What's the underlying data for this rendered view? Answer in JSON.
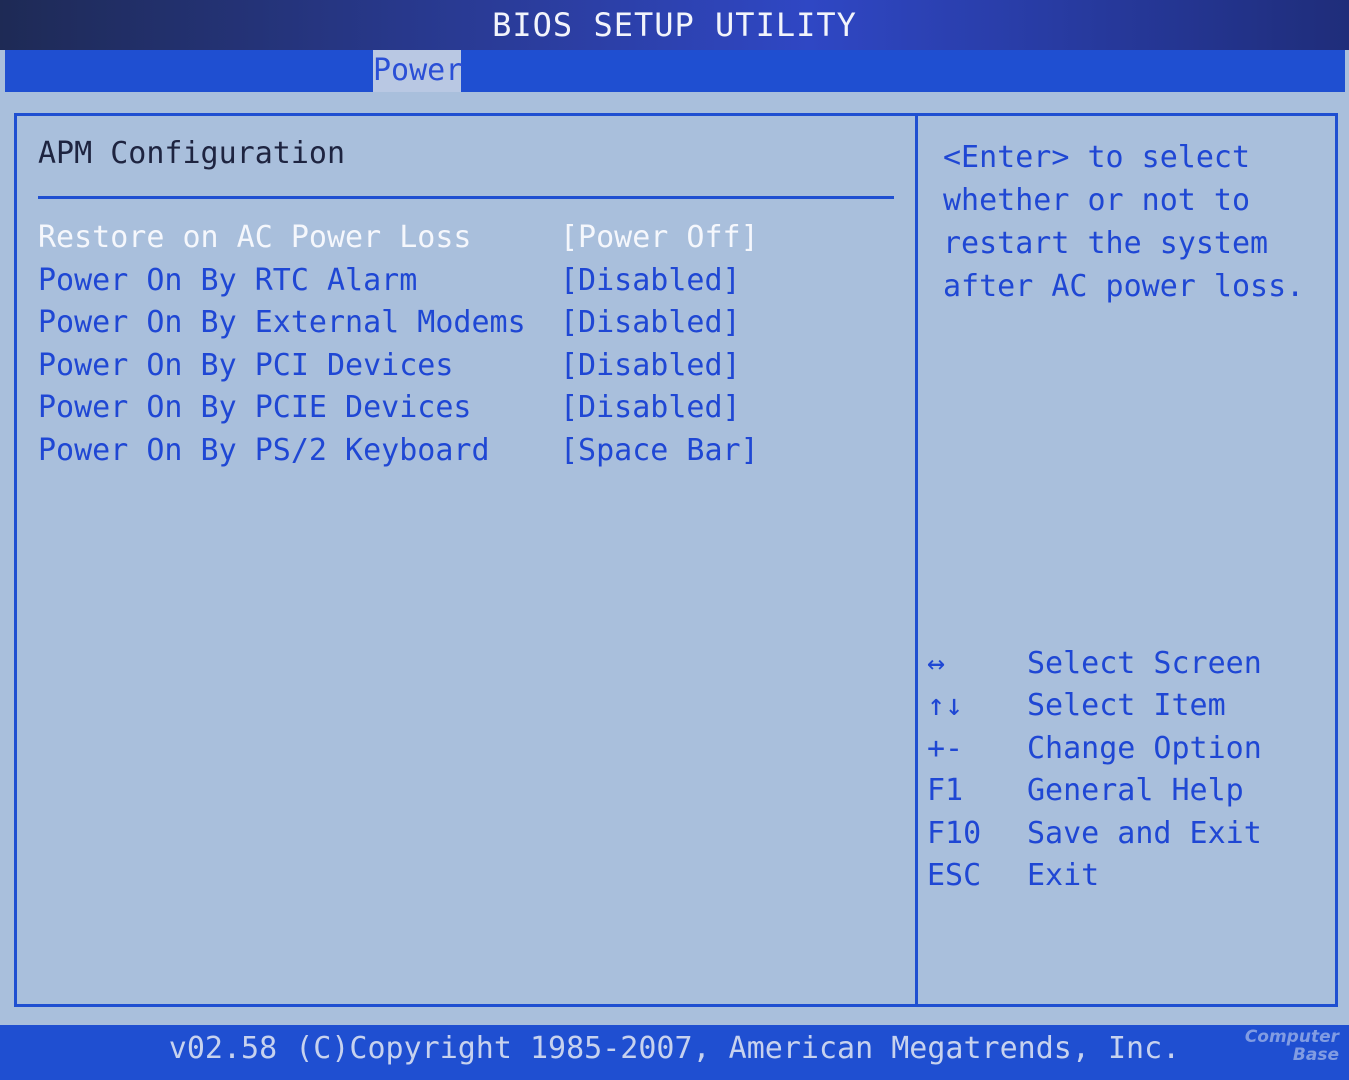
{
  "window": {
    "title": "BIOS SETUP UTILITY"
  },
  "menu": {
    "active_tab": "Power"
  },
  "section": {
    "title": "APM Configuration"
  },
  "settings": [
    {
      "label": "Restore on AC Power Loss",
      "value": "[Power Off]",
      "selected": true
    },
    {
      "label": "Power On By RTC Alarm",
      "value": "[Disabled]",
      "selected": false
    },
    {
      "label": "Power On By External Modems",
      "value": "[Disabled]",
      "selected": false
    },
    {
      "label": "Power On By PCI Devices",
      "value": "[Disabled]",
      "selected": false
    },
    {
      "label": "Power On By PCIE Devices",
      "value": "[Disabled]",
      "selected": false
    },
    {
      "label": "Power On By PS/2 Keyboard",
      "value": "[Space Bar]",
      "selected": false
    }
  ],
  "help": {
    "lines": [
      "<Enter> to select",
      "whether or not to",
      "restart the system",
      "after AC power loss."
    ]
  },
  "keys": [
    {
      "key": "↔",
      "desc": "Select Screen"
    },
    {
      "key": "↑↓",
      "desc": "Select Item"
    },
    {
      "key": "+-",
      "desc": "Change Option"
    },
    {
      "key": "F1",
      "desc": "General Help"
    },
    {
      "key": "F10",
      "desc": "Save and Exit"
    },
    {
      "key": "ESC",
      "desc": "Exit"
    }
  ],
  "footer": {
    "text": "v02.58 (C)Copyright 1985-2007, American Megatrends, Inc."
  },
  "watermark": {
    "line1": "Computer",
    "line2": "Base"
  },
  "colors": {
    "background": "#a9bfdc",
    "accent_blue": "#1f4fd1",
    "item_text": "#1f47d4",
    "selected_text": "#f5f7fc"
  }
}
